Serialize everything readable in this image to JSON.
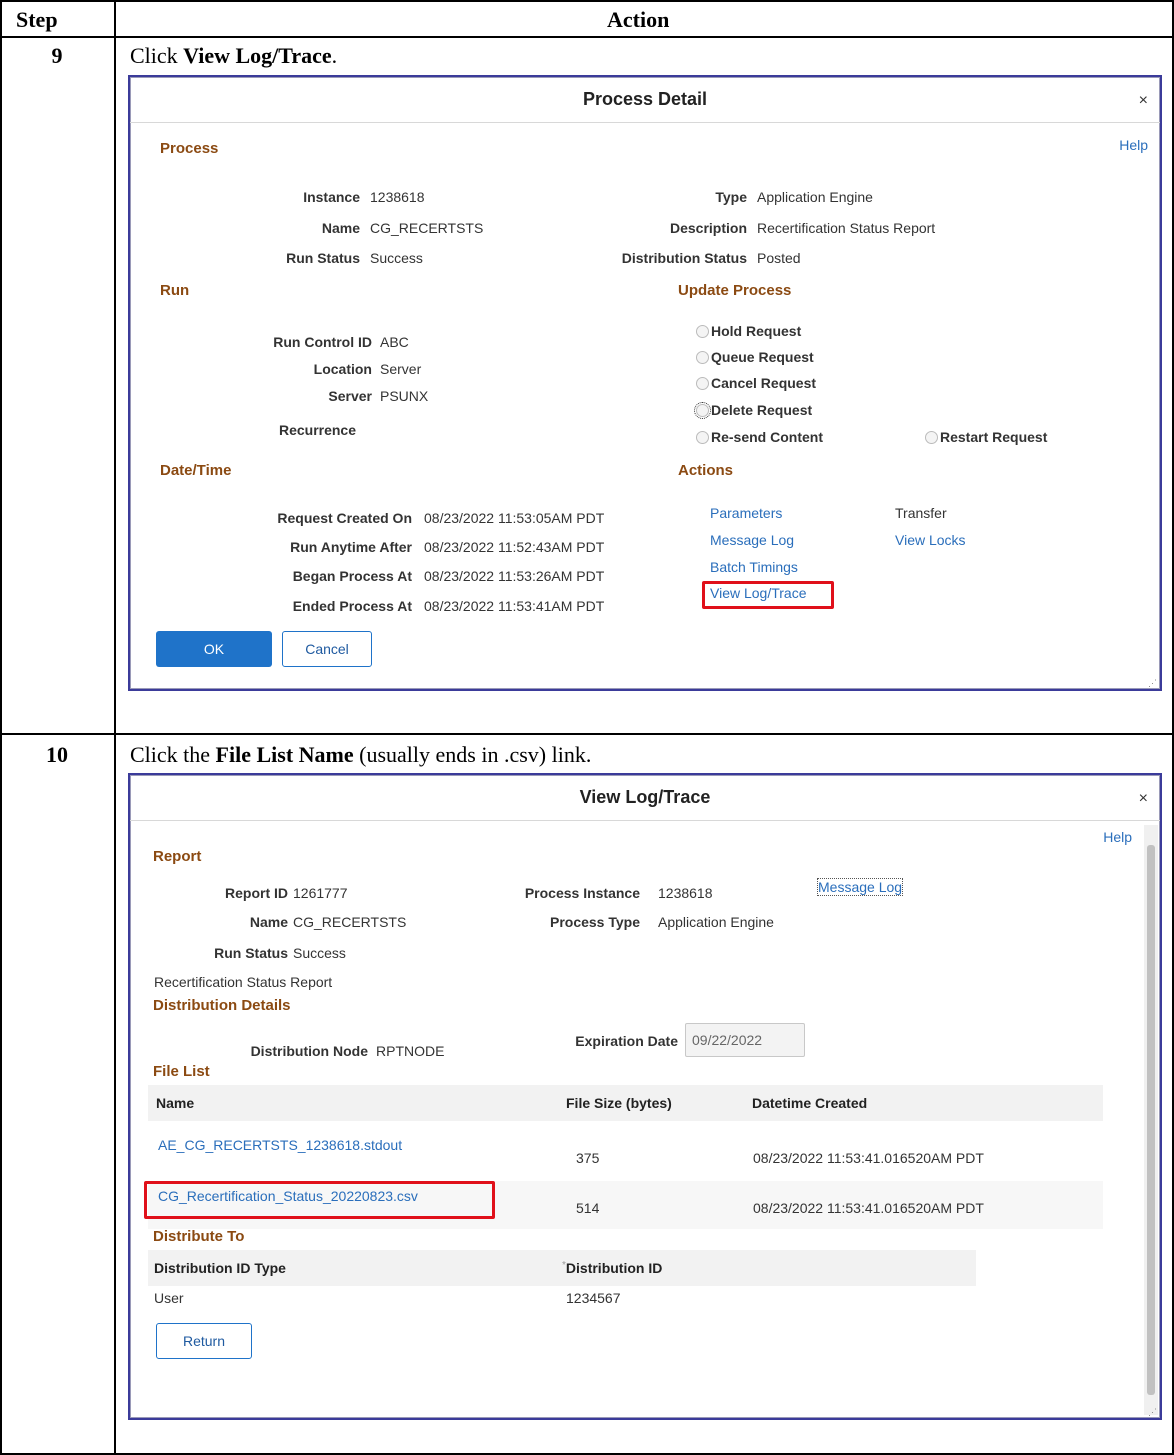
{
  "table": {
    "col_step": "Step",
    "col_action": "Action"
  },
  "steps": [
    {
      "number": "9",
      "instr_pre": "Click ",
      "instr_bold": "View Log/Trace",
      "instr_post": "."
    },
    {
      "number": "10",
      "instr_pre": "Click the ",
      "instr_bold": "File List Name",
      "instr_post": " (usually ends in .csv) link."
    }
  ],
  "process_detail": {
    "title": "Process Detail",
    "close": "×",
    "help": "Help",
    "process_section": "Process",
    "instance_label": "Instance",
    "instance_value": "1238618",
    "name_label": "Name",
    "name_value": "CG_RECERTSTS",
    "run_status_label": "Run Status",
    "run_status_value": "Success",
    "type_label": "Type",
    "type_value": "Application Engine",
    "description_label": "Description",
    "description_value": "Recertification Status Report",
    "dist_status_label": "Distribution Status",
    "dist_status_value": "Posted",
    "run_section": "Run",
    "run_control_label": "Run Control ID",
    "run_control_value": "ABC",
    "location_label": "Location",
    "location_value": "Server",
    "server_label": "Server",
    "server_value": "PSUNX",
    "recurrence_label": "Recurrence",
    "update_section": "Update Process",
    "radios": {
      "hold": "Hold Request",
      "queue": "Queue Request",
      "cancel": "Cancel Request",
      "delete": "Delete Request",
      "resend": "Re-send Content",
      "restart": "Restart Request"
    },
    "datetime_section": "Date/Time",
    "created_label": "Request Created On",
    "created_value": "08/23/2022 11:53:05AM PDT",
    "anytime_label": "Run Anytime After",
    "anytime_value": "08/23/2022 11:52:43AM PDT",
    "began_label": "Began Process At",
    "began_value": "08/23/2022 11:53:26AM PDT",
    "ended_label": "Ended Process At",
    "ended_value": "08/23/2022 11:53:41AM PDT",
    "actions_section": "Actions",
    "actions": {
      "parameters": "Parameters",
      "message_log": "Message Log",
      "batch_timings": "Batch Timings",
      "view_log_trace": "View Log/Trace",
      "transfer": "Transfer",
      "view_locks": "View Locks"
    },
    "ok": "OK",
    "cancel": "Cancel"
  },
  "view_log": {
    "title": "View Log/Trace",
    "close": "×",
    "help": "Help",
    "report_section": "Report",
    "report_id_label": "Report ID",
    "report_id_value": "1261777",
    "name_label": "Name",
    "name_value": "CG_RECERTSTS",
    "run_status_label": "Run Status",
    "run_status_value": "Success",
    "description": "Recertification Status Report",
    "process_instance_label": "Process Instance",
    "process_instance_value": "1238618",
    "process_type_label": "Process Type",
    "process_type_value": "Application Engine",
    "message_log": "Message Log",
    "dist_details_section": "Distribution Details",
    "dist_node_label": "Distribution Node",
    "dist_node_value": "RPTNODE",
    "expiration_label": "Expiration Date",
    "expiration_value": "09/22/2022",
    "file_list_section": "File List",
    "file_headers": {
      "name": "Name",
      "size": "File Size (bytes)",
      "created": "Datetime Created"
    },
    "files": [
      {
        "name": "AE_CG_RECERTSTS_1238618.stdout",
        "size": "375",
        "created": "08/23/2022 11:53:41.016520AM PDT"
      },
      {
        "name": "CG_Recertification_Status_20220823.csv",
        "size": "514",
        "created": "08/23/2022 11:53:41.016520AM PDT"
      }
    ],
    "distribute_section": "Distribute To",
    "dist_headers": {
      "type": "Distribution ID Type",
      "id_marker": "*",
      "id": "Distribution ID"
    },
    "dist_rows": [
      {
        "type": "User",
        "id": "1234567"
      }
    ],
    "return": "Return"
  }
}
